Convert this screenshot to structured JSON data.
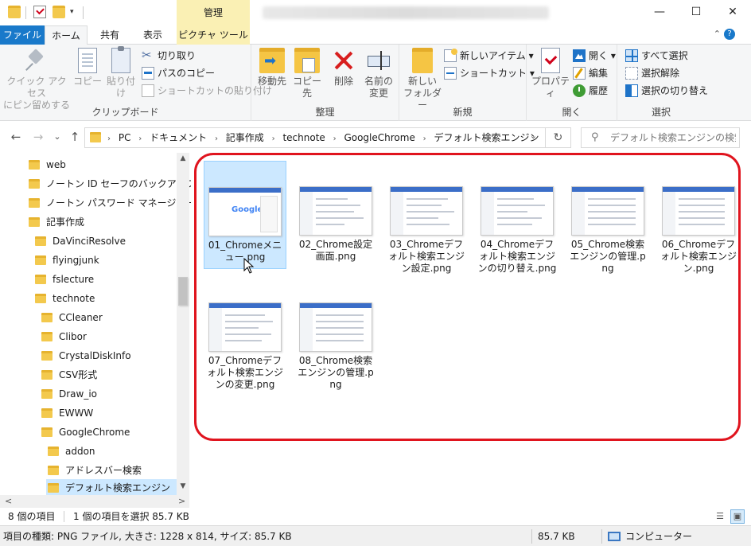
{
  "titlebar": {
    "manage_tab": "管理",
    "qa_dropdown": "▾",
    "minimize": "—",
    "maximize": "☐",
    "close": "✕"
  },
  "tabs": {
    "file": "ファイル",
    "home": "ホーム",
    "share": "共有",
    "view": "表示",
    "picture_tools": "ピクチャ ツール",
    "collapse": "⌃",
    "help": "?"
  },
  "ribbon": {
    "clipboard": {
      "label": "クリップボード",
      "pin": [
        "クイック アクセス",
        "にピン留めする"
      ],
      "copy": "コピー",
      "paste": "貼り付け",
      "cut": "切り取り",
      "copy_path": "パスのコピー",
      "paste_shortcut": "ショートカットの貼り付け"
    },
    "organize": {
      "label": "整理",
      "move_to": "移動先",
      "copy_to": "コピー先",
      "delete": "削除",
      "rename": [
        "名前の",
        "変更"
      ]
    },
    "new": {
      "label": "新規",
      "new_folder": [
        "新しい",
        "フォルダー"
      ],
      "new_item": "新しいアイテム ▾",
      "easy_access": "ショートカット ▾"
    },
    "open": {
      "label": "開く",
      "properties": "プロパティ",
      "open": "開く ▾",
      "edit": "編集",
      "history": "履歴"
    },
    "select": {
      "label": "選択",
      "select_all": "すべて選択",
      "select_none": "選択解除",
      "invert": "選択の切り替え"
    }
  },
  "nav": {
    "back": "←",
    "forward": "→",
    "recent": "⌄",
    "up": "↑",
    "breadcrumb": [
      "PC",
      "ドキュメント",
      "記事作成",
      "technote",
      "GoogleChrome",
      "デフォルト検索エンジン"
    ],
    "refresh": "↻",
    "search_placeholder": "デフォルト検索エンジンの検索",
    "search_icon": "⚲"
  },
  "tree": [
    "web",
    "ノートン ID セーフのバックアップ",
    "ノートン パスワード マネージャーのバッ",
    "記事作成",
    "DaVinciResolve",
    "flyingjunk",
    "fslecture",
    "technote",
    "CCleaner",
    "Clibor",
    "CrystalDiskInfo",
    "CSV形式",
    "Draw_io",
    "EWWW",
    "GoogleChrome",
    "addon",
    "アドレスバー検索",
    "デフォルト検索エンジン"
  ],
  "files": [
    "01_Chromeメニュー.png",
    "02_Chrome設定画面.png",
    "03_Chromeデフォルト検索エンジン設定.png",
    "04_Chromeデフォルト検索エンジンの切り替え.png",
    "05_Chrome検索エンジンの管理.png",
    "06_Chromeデフォルト検索エンジン.png",
    "07_Chromeデフォルト検索エンジンの変更.png",
    "08_Chrome検索エンジンの管理.png"
  ],
  "thumb_logo": "Google",
  "status": {
    "count": "8 個の項目",
    "selected": "1 個の項目を選択  85.7 KB"
  },
  "details": {
    "info": "項目の種類: PNG ファイル, 大きさ: 1228 x 814, サイズ: 85.7 KB",
    "size": "85.7 KB",
    "location": "コンピューター"
  },
  "scroll": {
    "up": "▲",
    "down": "▼",
    "left": "<",
    "right": ">"
  },
  "views": {
    "details": "☰",
    "large": "▣"
  },
  "colors": {
    "accent": "#1979ca",
    "picture_tools": "#faf0b4",
    "selection": "#cce8ff",
    "highlight_outline": "#e0141e"
  }
}
